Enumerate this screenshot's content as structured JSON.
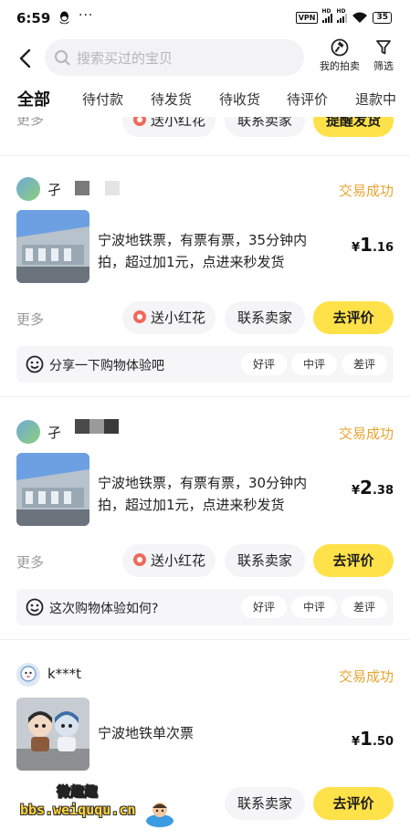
{
  "status_bar": {
    "time": "6:59",
    "dots": "···",
    "vpn": "VPN",
    "hd1": "HD",
    "hd2": "HD",
    "battery": "35"
  },
  "header": {
    "search_placeholder": "搜索买过的宝贝",
    "my_auction": "我的拍卖",
    "filter": "筛选"
  },
  "tabs": [
    "全部",
    "待付款",
    "待发货",
    "待收货",
    "待评价",
    "退款中"
  ],
  "partial_row": {
    "more": "更多",
    "flower": "送小红花",
    "contact": "联系卖家",
    "remind": "提醒发货"
  },
  "orders": [
    {
      "seller": "孑",
      "status": "交易成功",
      "title": "宁波地铁票，有票有票，35分钟内拍，超过加1元，点进来秒发货",
      "price_currency": "¥",
      "price_int": "1",
      "price_dec": ".16",
      "more": "更多",
      "flower": "送小红花",
      "contact": "联系卖家",
      "action": "去评价",
      "review_prompt": "分享一下购物体验吧",
      "review_good": "好评",
      "review_mid": "中评",
      "review_bad": "差评"
    },
    {
      "seller": "孑",
      "status": "交易成功",
      "title": "宁波地铁票，有票有票，30分钟内拍，超过加1元，点进来秒发货",
      "price_currency": "¥",
      "price_int": "2",
      "price_dec": ".38",
      "more": "更多",
      "flower": "送小红花",
      "contact": "联系卖家",
      "action": "去评价",
      "review_prompt": "这次购物体验如何?",
      "review_good": "好评",
      "review_mid": "中评",
      "review_bad": "差评"
    },
    {
      "seller": "k***t",
      "status": "交易成功",
      "title": "宁波地铁单次票",
      "price_currency": "¥",
      "price_int": "1",
      "price_dec": ".50",
      "contact": "联系卖家",
      "action": "去评价"
    }
  ],
  "watermark": {
    "top": "微趣趣",
    "bottom": "bbs.weiququ.cn"
  },
  "colors": {
    "accent_yellow": "#ffe14a",
    "status_orange": "#e7a531",
    "pill_gray": "#f5f5f7"
  }
}
